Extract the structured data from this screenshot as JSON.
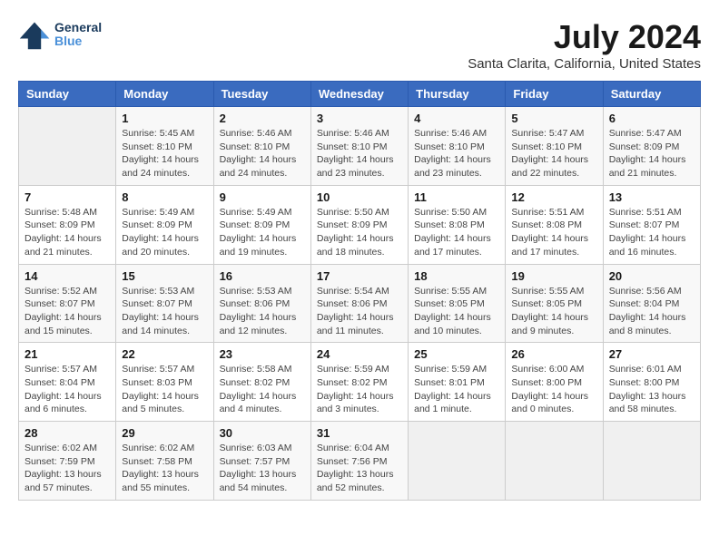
{
  "header": {
    "logo_line1": "General",
    "logo_line2": "Blue",
    "month_title": "July 2024",
    "location": "Santa Clarita, California, United States"
  },
  "weekdays": [
    "Sunday",
    "Monday",
    "Tuesday",
    "Wednesday",
    "Thursday",
    "Friday",
    "Saturday"
  ],
  "weeks": [
    [
      {
        "day": "",
        "info": ""
      },
      {
        "day": "1",
        "info": "Sunrise: 5:45 AM\nSunset: 8:10 PM\nDaylight: 14 hours\nand 24 minutes."
      },
      {
        "day": "2",
        "info": "Sunrise: 5:46 AM\nSunset: 8:10 PM\nDaylight: 14 hours\nand 24 minutes."
      },
      {
        "day": "3",
        "info": "Sunrise: 5:46 AM\nSunset: 8:10 PM\nDaylight: 14 hours\nand 23 minutes."
      },
      {
        "day": "4",
        "info": "Sunrise: 5:46 AM\nSunset: 8:10 PM\nDaylight: 14 hours\nand 23 minutes."
      },
      {
        "day": "5",
        "info": "Sunrise: 5:47 AM\nSunset: 8:10 PM\nDaylight: 14 hours\nand 22 minutes."
      },
      {
        "day": "6",
        "info": "Sunrise: 5:47 AM\nSunset: 8:09 PM\nDaylight: 14 hours\nand 21 minutes."
      }
    ],
    [
      {
        "day": "7",
        "info": "Sunrise: 5:48 AM\nSunset: 8:09 PM\nDaylight: 14 hours\nand 21 minutes."
      },
      {
        "day": "8",
        "info": "Sunrise: 5:49 AM\nSunset: 8:09 PM\nDaylight: 14 hours\nand 20 minutes."
      },
      {
        "day": "9",
        "info": "Sunrise: 5:49 AM\nSunset: 8:09 PM\nDaylight: 14 hours\nand 19 minutes."
      },
      {
        "day": "10",
        "info": "Sunrise: 5:50 AM\nSunset: 8:09 PM\nDaylight: 14 hours\nand 18 minutes."
      },
      {
        "day": "11",
        "info": "Sunrise: 5:50 AM\nSunset: 8:08 PM\nDaylight: 14 hours\nand 17 minutes."
      },
      {
        "day": "12",
        "info": "Sunrise: 5:51 AM\nSunset: 8:08 PM\nDaylight: 14 hours\nand 17 minutes."
      },
      {
        "day": "13",
        "info": "Sunrise: 5:51 AM\nSunset: 8:07 PM\nDaylight: 14 hours\nand 16 minutes."
      }
    ],
    [
      {
        "day": "14",
        "info": "Sunrise: 5:52 AM\nSunset: 8:07 PM\nDaylight: 14 hours\nand 15 minutes."
      },
      {
        "day": "15",
        "info": "Sunrise: 5:53 AM\nSunset: 8:07 PM\nDaylight: 14 hours\nand 14 minutes."
      },
      {
        "day": "16",
        "info": "Sunrise: 5:53 AM\nSunset: 8:06 PM\nDaylight: 14 hours\nand 12 minutes."
      },
      {
        "day": "17",
        "info": "Sunrise: 5:54 AM\nSunset: 8:06 PM\nDaylight: 14 hours\nand 11 minutes."
      },
      {
        "day": "18",
        "info": "Sunrise: 5:55 AM\nSunset: 8:05 PM\nDaylight: 14 hours\nand 10 minutes."
      },
      {
        "day": "19",
        "info": "Sunrise: 5:55 AM\nSunset: 8:05 PM\nDaylight: 14 hours\nand 9 minutes."
      },
      {
        "day": "20",
        "info": "Sunrise: 5:56 AM\nSunset: 8:04 PM\nDaylight: 14 hours\nand 8 minutes."
      }
    ],
    [
      {
        "day": "21",
        "info": "Sunrise: 5:57 AM\nSunset: 8:04 PM\nDaylight: 14 hours\nand 6 minutes."
      },
      {
        "day": "22",
        "info": "Sunrise: 5:57 AM\nSunset: 8:03 PM\nDaylight: 14 hours\nand 5 minutes."
      },
      {
        "day": "23",
        "info": "Sunrise: 5:58 AM\nSunset: 8:02 PM\nDaylight: 14 hours\nand 4 minutes."
      },
      {
        "day": "24",
        "info": "Sunrise: 5:59 AM\nSunset: 8:02 PM\nDaylight: 14 hours\nand 3 minutes."
      },
      {
        "day": "25",
        "info": "Sunrise: 5:59 AM\nSunset: 8:01 PM\nDaylight: 14 hours\nand 1 minute."
      },
      {
        "day": "26",
        "info": "Sunrise: 6:00 AM\nSunset: 8:00 PM\nDaylight: 14 hours\nand 0 minutes."
      },
      {
        "day": "27",
        "info": "Sunrise: 6:01 AM\nSunset: 8:00 PM\nDaylight: 13 hours\nand 58 minutes."
      }
    ],
    [
      {
        "day": "28",
        "info": "Sunrise: 6:02 AM\nSunset: 7:59 PM\nDaylight: 13 hours\nand 57 minutes."
      },
      {
        "day": "29",
        "info": "Sunrise: 6:02 AM\nSunset: 7:58 PM\nDaylight: 13 hours\nand 55 minutes."
      },
      {
        "day": "30",
        "info": "Sunrise: 6:03 AM\nSunset: 7:57 PM\nDaylight: 13 hours\nand 54 minutes."
      },
      {
        "day": "31",
        "info": "Sunrise: 6:04 AM\nSunset: 7:56 PM\nDaylight: 13 hours\nand 52 minutes."
      },
      {
        "day": "",
        "info": ""
      },
      {
        "day": "",
        "info": ""
      },
      {
        "day": "",
        "info": ""
      }
    ]
  ]
}
